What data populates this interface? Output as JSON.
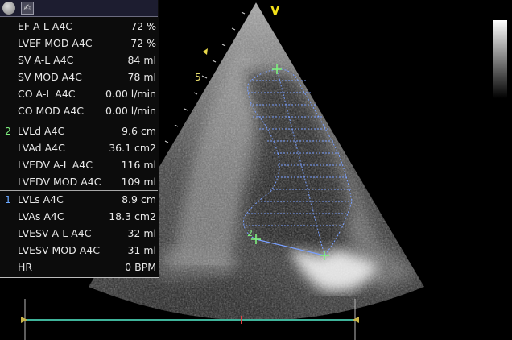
{
  "panel": {
    "groups": [
      {
        "marker": "",
        "rows": [
          {
            "label": "EF A-L A4C",
            "value": "72 %"
          },
          {
            "label": "LVEF MOD A4C",
            "value": "72 %"
          },
          {
            "label": "SV A-L A4C",
            "value": "84 ml"
          },
          {
            "label": "SV MOD A4C",
            "value": "78 ml"
          },
          {
            "label": "CO A-L A4C",
            "value": "0.00 l/min"
          },
          {
            "label": "CO MOD A4C",
            "value": "0.00 l/min"
          }
        ]
      },
      {
        "marker": "2",
        "marker_color": "#7ff07f",
        "rows": [
          {
            "label": "LVLd A4C",
            "value": "9.6 cm"
          },
          {
            "label": "LVAd A4C",
            "value": "36.1 cm2"
          },
          {
            "label": "LVEDV A-L A4C",
            "value": "116 ml"
          },
          {
            "label": "LVEDV MOD A4C",
            "value": "109 ml"
          }
        ]
      },
      {
        "marker": "1",
        "marker_color": "#6aa8ff",
        "rows": [
          {
            "label": "LVLs A4C",
            "value": "8.9 cm"
          },
          {
            "label": "LVAs A4C",
            "value": "18.3 cm2"
          },
          {
            "label": "LVESV A-L A4C",
            "value": "32 ml"
          },
          {
            "label": "LVESV MOD A4C",
            "value": "31 ml"
          },
          {
            "label": "HR",
            "value": "0 BPM"
          }
        ]
      }
    ]
  },
  "image": {
    "orientation_marker": "V",
    "depth_label": "5",
    "trace_label": "2"
  },
  "colors": {
    "trace": "#7aa0ff",
    "caliper": "#7ff07f",
    "orientation": "#f2e018",
    "scale_bar": "#3fb39a"
  }
}
